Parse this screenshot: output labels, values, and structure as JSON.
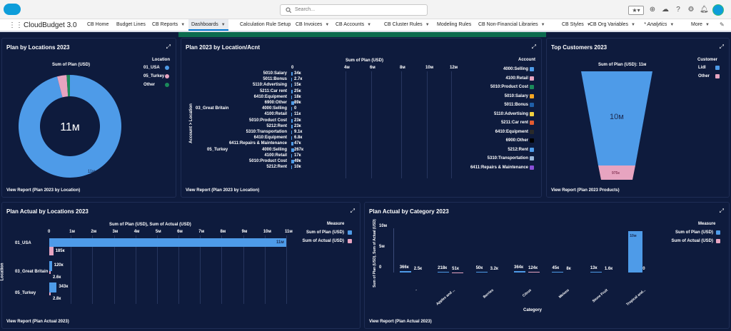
{
  "search": {
    "placeholder": "Search..."
  },
  "app": {
    "name": "CloudBudget 3.0"
  },
  "nav": [
    {
      "label": "CB Home",
      "dd": false
    },
    {
      "label": "Budget Lines",
      "dd": false
    },
    {
      "label": "CB Reports",
      "dd": true
    },
    {
      "label": "Dashboards",
      "dd": true,
      "active": true
    },
    {
      "label": "Calculation Rule Setup",
      "dd": false
    },
    {
      "label": "CB Invoices",
      "dd": true
    },
    {
      "label": "CB Accounts",
      "dd": true
    },
    {
      "label": "CB Cluster Rules",
      "dd": true
    },
    {
      "label": "Modeling Rules",
      "dd": false
    },
    {
      "label": "CB Non-Financial Libraries",
      "dd": true
    },
    {
      "label": "CB Styles",
      "dd": true
    },
    {
      "label": "CB Org Variables",
      "dd": true
    },
    {
      "label": "* Analytics",
      "dd": true,
      "italic": true
    },
    {
      "label": "More",
      "dd": true
    }
  ],
  "colors": {
    "blue": "#4e9be8",
    "pink": "#e7a4c0",
    "green": "#1b8a5a"
  },
  "tile1": {
    "title": "Plan by Locations 2023",
    "view": "View Report (Plan 2023 by Location)",
    "measure": "Sum of Plan (USD)",
    "center": "11м",
    "slice_label": "11м",
    "legend_title": "Location",
    "legend": [
      {
        "label": "01_USA",
        "color": "#4e9be8"
      },
      {
        "label": "05_Turkey",
        "color": "#e7a4c0"
      },
      {
        "label": "Other",
        "color": "#1b8a5a"
      }
    ],
    "chart_data": {
      "type": "pie",
      "title": "Plan by Locations 2023",
      "measure": "Sum of Plan (USD)",
      "categories": [
        "01_USA",
        "05_Turkey",
        "Other"
      ],
      "values": [
        11000000,
        343000,
        120000
      ],
      "total": "11м"
    }
  },
  "tile2": {
    "title": "Plan 2023 by Location/Acnt",
    "view": "View Report (Plan 2023 by Location)",
    "measure": "Sum of Plan (USD)",
    "yaxis": "Account > Location",
    "ticks": [
      "0",
      "4м",
      "6м",
      "8м",
      "10м",
      "12м"
    ],
    "legend_title": "Account",
    "groups": [
      "03_Great Britain",
      "05_Turkey"
    ],
    "rows": [
      {
        "label": "5010:Salary",
        "val": "34к"
      },
      {
        "label": "5011:Bonus",
        "val": "2.7к"
      },
      {
        "label": "5110:Advertising",
        "val": "15к"
      },
      {
        "label": "5211:Car rent",
        "val": "25к"
      },
      {
        "label": "6410:Equipment",
        "val": "18к"
      },
      {
        "label": "6900:Other",
        "val": "89к"
      },
      {
        "label": "4000:Selling",
        "val": "0"
      },
      {
        "label": "4100:Retail",
        "val": "11к"
      },
      {
        "label": "5010:Product Cost",
        "val": "23к"
      },
      {
        "label": "5212:Rent",
        "val": "23к"
      },
      {
        "label": "5310:Transportation",
        "val": "9.1к"
      },
      {
        "label": "6410:Equipment",
        "val": "6.8к"
      },
      {
        "label": "6411:Repairs & Maintenance",
        "val": "47к"
      },
      {
        "label": "4000:Selling",
        "val": "267к"
      },
      {
        "label": "4100:Retail",
        "val": "17к"
      },
      {
        "label": "5010:Product Cost",
        "val": "49к"
      },
      {
        "label": "5212:Rent",
        "val": "10к"
      }
    ],
    "legend": [
      {
        "label": "4000:Selling",
        "color": "#4e9be8"
      },
      {
        "label": "4100:Retail",
        "color": "#e7a4c0"
      },
      {
        "label": "5010:Product Cost",
        "color": "#1b8a5a"
      },
      {
        "label": "5010:Salary",
        "color": "#f5a623"
      },
      {
        "label": "5011:Bonus",
        "color": "#1f5fa8"
      },
      {
        "label": "5110:Advertising",
        "color": "#f0d040"
      },
      {
        "label": "5211:Car rent",
        "color": "#e35b30"
      },
      {
        "label": "6410:Equipment",
        "color": "#2a2a2a"
      },
      {
        "label": "6900:Other",
        "color": "#000000"
      },
      {
        "label": "5212:Rent",
        "color": "#4e9be8"
      },
      {
        "label": "5310:Transportation",
        "color": "#9ab6d8"
      },
      {
        "label": "6411:Repairs & Maintenance",
        "color": "#8a4fd8"
      }
    ],
    "chart_data": {
      "type": "bar",
      "orientation": "horizontal",
      "title": "Plan 2023 by Location/Acnt",
      "measure": "Sum of Plan (USD)",
      "ylabel": "Account > Location",
      "xlim": [
        0,
        12000000
      ],
      "categories": [
        "5010:Salary",
        "5011:Bonus",
        "5110:Advertising",
        "5211:Car rent",
        "6410:Equipment",
        "6900:Other",
        "03_Great Britain / 4000:Selling",
        "4100:Retail",
        "5010:Product Cost",
        "5212:Rent",
        "5310:Transportation",
        "6410:Equipment",
        "6411:Repairs & Maintenance",
        "05_Turkey / 4000:Selling",
        "4100:Retail",
        "5010:Product Cost",
        "5212:Rent"
      ],
      "values": [
        34000,
        2700,
        15000,
        25000,
        18000,
        89000,
        0,
        11000,
        23000,
        23000,
        9100,
        6800,
        47000,
        267000,
        17000,
        49000,
        10000
      ]
    }
  },
  "tile3": {
    "title": "Top Customers 2023",
    "view": "View Report (Plan 2023 Products)",
    "header": "Sum of Plan (USD): 11м",
    "legend_title": "Customer",
    "top_label": "10м",
    "bottom_label": "975к",
    "legend": [
      {
        "label": "Lidl",
        "color": "#4e9be8"
      },
      {
        "label": "Other",
        "color": "#e7a4c0"
      }
    ],
    "chart_data": {
      "type": "bar",
      "subtype": "funnel",
      "title": "Top Customers 2023",
      "measure": "Sum of Plan (USD)",
      "total": "11м",
      "categories": [
        "Lidl",
        "Other"
      ],
      "values": [
        10000000,
        975000
      ]
    }
  },
  "tile4": {
    "title": "Plan Actual by Locations 2023",
    "view": "View Report (Plan Actual 2023)",
    "measure": "Sum of Plan (USD), Sum of Actual (USD)",
    "yaxis": "Location",
    "ticks": [
      "0",
      "1м",
      "2м",
      "3м",
      "4м",
      "5м",
      "6м",
      "7м",
      "8м",
      "9м",
      "10м",
      "11м"
    ],
    "legend_title": "Measure",
    "legend": [
      {
        "label": "Sum of Plan (USD)",
        "color": "#4e9be8"
      },
      {
        "label": "Sum of Actual (USD)",
        "color": "#e7a4c0"
      }
    ],
    "rows": [
      {
        "label": "01_USA",
        "plan": "11м",
        "actual": "185к"
      },
      {
        "label": "03_Great Britain",
        "plan": "120к",
        "actual": "2.6к"
      },
      {
        "label": "05_Turkey",
        "plan": "343к",
        "actual": "2.8к"
      }
    ],
    "chart_data": {
      "type": "bar",
      "orientation": "horizontal",
      "title": "Plan Actual by Locations 2023",
      "ylabel": "Location",
      "xlim": [
        0,
        11000000
      ],
      "categories": [
        "01_USA",
        "03_Great Britain",
        "05_Turkey"
      ],
      "series": [
        {
          "name": "Sum of Plan (USD)",
          "values": [
            11000000,
            120000,
            343000
          ]
        },
        {
          "name": "Sum of Actual (USD)",
          "values": [
            185000,
            2600,
            2800
          ]
        }
      ]
    }
  },
  "tile5": {
    "title": "Plan Actual by Category 2023",
    "view": "View Report (Plan Actual 2023)",
    "yaxis": "Sum of Plan (USD), Sum of Actual (USD)",
    "xaxis": "Category",
    "ticks": [
      "0",
      "5м",
      "10м"
    ],
    "legend_title": "Measure",
    "legend": [
      {
        "label": "Sum of Plan (USD)",
        "color": "#4e9be8"
      },
      {
        "label": "Sum of Actual (USD)",
        "color": "#e7a4c0"
      }
    ],
    "cats": [
      {
        "label": "-",
        "plan": "366к",
        "actual": "2.5к"
      },
      {
        "label": "Apples and ...",
        "plan": "218к",
        "actual": "51к"
      },
      {
        "label": "Berries",
        "plan": "50к",
        "actual": "3.2к"
      },
      {
        "label": "Citrus",
        "plan": "364к",
        "actual": "124к"
      },
      {
        "label": "Melons",
        "plan": "45к",
        "actual": "8к"
      },
      {
        "label": "Stone Fruit",
        "plan": "13к",
        "actual": "1.6к"
      },
      {
        "label": "Tropical and...",
        "plan": "10м",
        "actual": "0"
      }
    ],
    "chart_data": {
      "type": "bar",
      "title": "Plan Actual by Category 2023",
      "xlabel": "Category",
      "ylabel": "Sum of Plan (USD), Sum of Actual (USD)",
      "ylim": [
        0,
        10000000
      ],
      "categories": [
        "-",
        "Apples and ...",
        "Berries",
        "Citrus",
        "Melons",
        "Stone Fruit",
        "Tropical and..."
      ],
      "series": [
        {
          "name": "Sum of Plan (USD)",
          "values": [
            366000,
            218000,
            50000,
            364000,
            45000,
            13000,
            10000000
          ]
        },
        {
          "name": "Sum of Actual (USD)",
          "values": [
            2500,
            51000,
            3200,
            124000,
            8000,
            1600,
            0
          ]
        }
      ]
    }
  }
}
